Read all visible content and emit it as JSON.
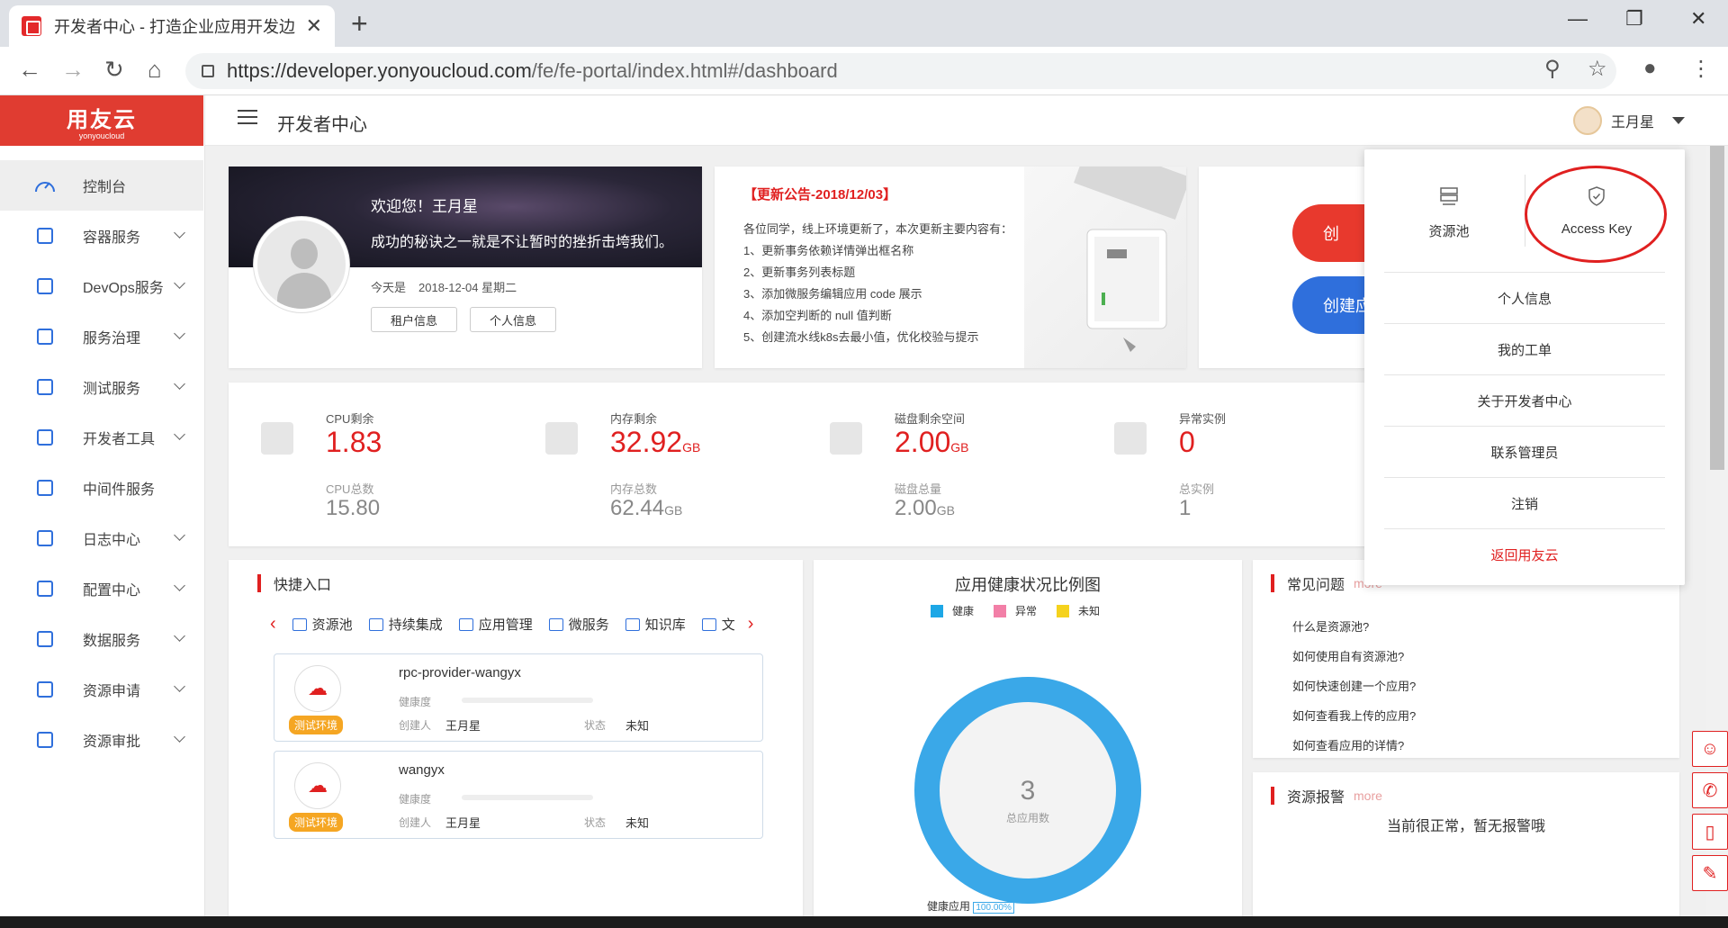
{
  "browser": {
    "tab_title": "开发者中心 - 打造企业应用开发边",
    "url_host": "https://developer.yonyoucloud.com",
    "url_path": "/fe/fe-portal/index.html#/dashboard"
  },
  "sidebar": {
    "logo_main": "用友云",
    "logo_sub": "yonyoucloud",
    "items": [
      {
        "label": "控制台",
        "icon": "dashboard-icon"
      },
      {
        "label": "容器服务",
        "icon": "container-icon"
      },
      {
        "label": "DevOps服务",
        "icon": "devops-icon"
      },
      {
        "label": "服务治理",
        "icon": "monitor-icon"
      },
      {
        "label": "测试服务",
        "icon": "test-icon"
      },
      {
        "label": "开发者工具",
        "icon": "tools-icon"
      },
      {
        "label": "中间件服务",
        "icon": "layers-icon"
      },
      {
        "label": "日志中心",
        "icon": "log-icon"
      },
      {
        "label": "配置中心",
        "icon": "config-icon"
      },
      {
        "label": "数据服务",
        "icon": "search-data-icon"
      },
      {
        "label": "资源申请",
        "icon": "apply-icon"
      },
      {
        "label": "资源审批",
        "icon": "approve-icon"
      }
    ]
  },
  "header": {
    "title": "开发者中心",
    "user_name": "王月星"
  },
  "welcome": {
    "greeting": "欢迎您！王月星",
    "motto": "成功的秘诀之一就是不让暂时的挫折击垮我们。",
    "today_label": "今天是",
    "date": "2018-12-04 星期二",
    "btn_tenant": "租户信息",
    "btn_profile": "个人信息"
  },
  "notice": {
    "title": "【更新公告-2018/12/03】",
    "lines": [
      "各位同学，线上环境更新了，本次更新主要内容有：",
      "1、更新事务依赖详情弹出框名称",
      "2、更新事务列表标题",
      "3、添加微服务编辑应用 code 展示",
      "4、添加空判断的 null 值判断",
      "5、创建流水线k8s去最小值，优化校验与提示"
    ]
  },
  "create": {
    "btn1": "创",
    "btn2": "创建应"
  },
  "stats": [
    {
      "label": "CPU剩余",
      "value": "1.83",
      "unit": "",
      "label2": "CPU总数",
      "value2": "15.80",
      "unit2": ""
    },
    {
      "label": "内存剩余",
      "value": "32.92",
      "unit": "GB",
      "label2": "内存总数",
      "value2": "62.44",
      "unit2": "GB"
    },
    {
      "label": "磁盘剩余空间",
      "value": "2.00",
      "unit": "GB",
      "label2": "磁盘总量",
      "value2": "2.00",
      "unit2": "GB"
    },
    {
      "label": "异常实例",
      "value": "0",
      "unit": "",
      "label2": "总实例",
      "value2": "1",
      "unit2": ""
    }
  ],
  "quick": {
    "title": "快捷入口",
    "nav": [
      "资源池",
      "持续集成",
      "应用管理",
      "微服务",
      "知识库",
      "文"
    ],
    "apps": [
      {
        "name": "rpc-provider-wangyx",
        "tag": "测试环境",
        "health_label": "健康度",
        "creator_label": "创建人",
        "creator": "王月星",
        "status_label": "状态",
        "status": "未知"
      },
      {
        "name": "wangyx",
        "tag": "测试环境",
        "health_label": "健康度",
        "creator_label": "创建人",
        "creator": "王月星",
        "status_label": "状态",
        "status": "未知"
      }
    ]
  },
  "health": {
    "title": "应用健康状况比例图",
    "legend": [
      {
        "label": "健康",
        "color": "#1da7e6"
      },
      {
        "label": "异常",
        "color": "#f27fa7"
      },
      {
        "label": "未知",
        "color": "#f5d21d"
      }
    ],
    "total": "3",
    "total_label": "总应用数",
    "footer_label": "健康应用",
    "footer_pct": "100.00%"
  },
  "faq": {
    "title": "常见问题",
    "more": "more",
    "items": [
      "什么是资源池?",
      "如何使用自有资源池?",
      "如何快速创建一个应用?",
      "如何查看我上传的应用?",
      "如何查看应用的详情?"
    ]
  },
  "alarm": {
    "title": "资源报警",
    "more": "more",
    "message": "当前很正常，暂无报警哦"
  },
  "dropdown": {
    "pool": "资源池",
    "access_key": "Access Key",
    "items": [
      "个人信息",
      "我的工单",
      "关于开发者中心",
      "联系管理员",
      "注销"
    ],
    "back": "返回用友云"
  }
}
